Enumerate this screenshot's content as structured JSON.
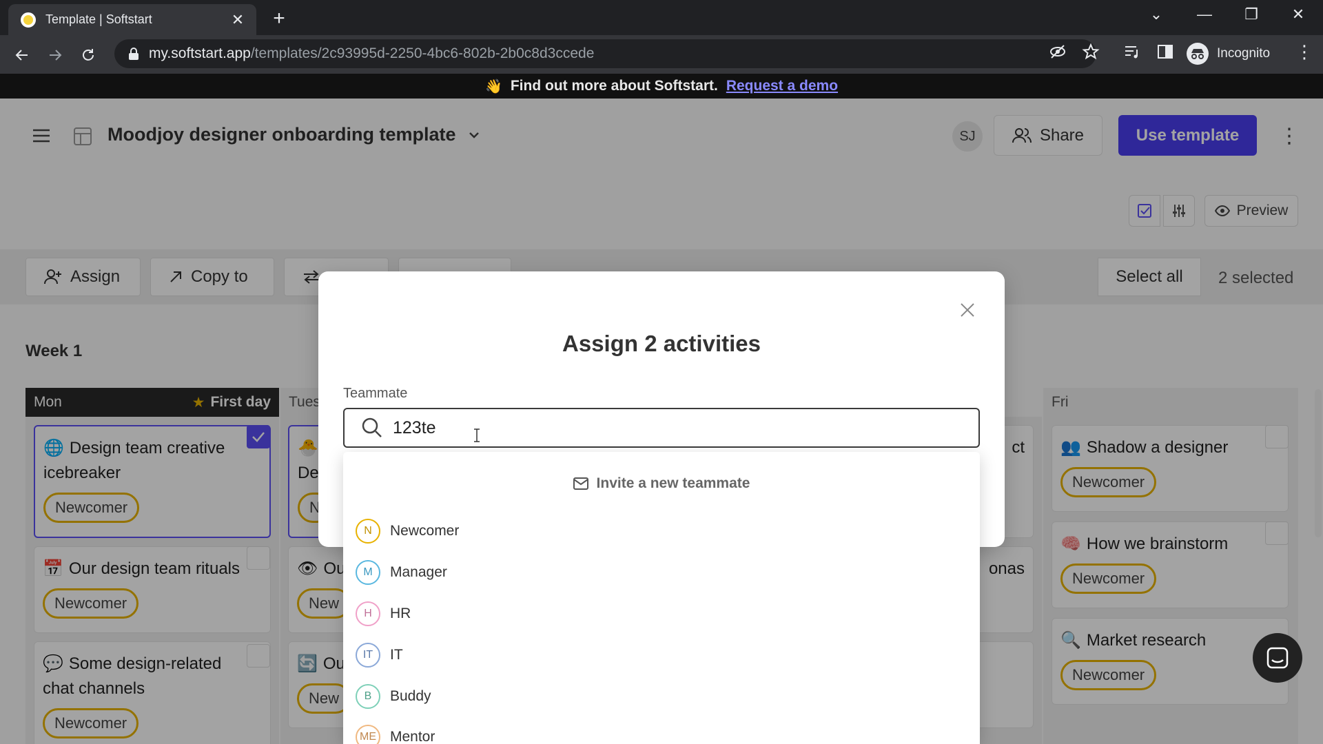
{
  "browser": {
    "tab_title": "Template | Softstart",
    "url_domain": "my.softstart.app",
    "url_path": "/templates/2c93995d-2250-4bc6-802b-2b0c8d3ccede",
    "incognito_label": "Incognito"
  },
  "banner": {
    "text": "Find out more about Softstart.",
    "link": "Request a demo"
  },
  "header": {
    "title": "Moodjoy designer onboarding template",
    "avatar_initials": "SJ",
    "share_label": "Share",
    "use_template_label": "Use template",
    "preview_label": "Preview"
  },
  "toolbar": {
    "assign_label": "Assign",
    "copy_label": "Copy to",
    "select_all_label": "Select all",
    "selected_count": "2 selected"
  },
  "board": {
    "week_label": "Week 1",
    "days": {
      "mon": "Mon",
      "mon_badge": "First day",
      "tue": "Tues",
      "fri": "Fri"
    },
    "mon_cards": [
      {
        "emoji": "🔵",
        "title": "Design team creative icebreaker",
        "tag": "Newcomer"
      },
      {
        "emoji": "📅",
        "title": "Our design team rituals",
        "tag": "Newcomer"
      },
      {
        "emoji": "💬",
        "title": "Some design-related chat channels",
        "tag": "Newcomer"
      }
    ],
    "tue_cards": [
      {
        "emoji": "🐣",
        "title_fragment": "De",
        "tag_fragment": "N"
      },
      {
        "emoji": "👁",
        "title_fragment": "Ou",
        "tag_fragment": "New"
      },
      {
        "emoji": "🔄",
        "title_fragment": "Ou",
        "tag_fragment": "New"
      }
    ],
    "thu_fragments": [
      "ct",
      "onas"
    ],
    "fri_cards": [
      {
        "emoji": "👥",
        "title": "Shadow a designer",
        "tag": "Newcomer"
      },
      {
        "emoji": "🧠",
        "title": "How we brainstorm",
        "tag": "Newcomer"
      },
      {
        "emoji": "🔍",
        "title": "Market research",
        "tag": "Newcomer"
      }
    ]
  },
  "modal": {
    "title": "Assign 2 activities",
    "field_label": "Teammate",
    "search_value": "123te",
    "invite_label": "Invite a new teammate",
    "options": [
      {
        "initials": "N",
        "label": "Newcomer",
        "color": "#e8b200"
      },
      {
        "initials": "M",
        "label": "Manager",
        "color": "#5ab8e0"
      },
      {
        "initials": "H",
        "label": "HR",
        "color": "#f0a0c8"
      },
      {
        "initials": "IT",
        "label": "IT",
        "color": "#8aa8d8"
      },
      {
        "initials": "B",
        "label": "Buddy",
        "color": "#7ed0b8"
      },
      {
        "initials": "ME",
        "label": "Mentor",
        "color": "#f0b880"
      }
    ]
  },
  "colors": {
    "accent": "#4a3df0",
    "tag_border": "#e8b200"
  }
}
